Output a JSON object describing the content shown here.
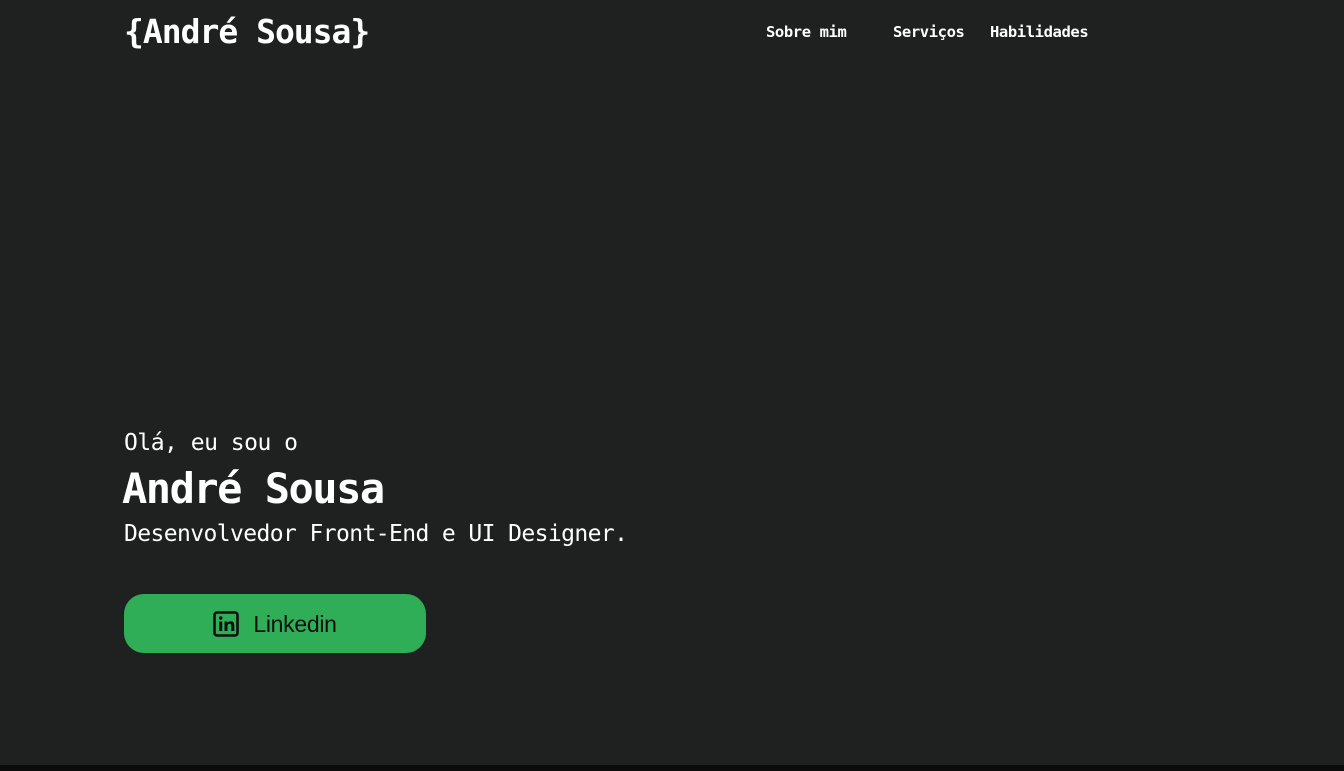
{
  "header": {
    "logo": "{André Sousa}",
    "nav": [
      {
        "label": "Sobre mim"
      },
      {
        "label": "Serviços"
      },
      {
        "label": "Habilidades"
      }
    ]
  },
  "hero": {
    "greeting": "Olá, eu sou o",
    "name": "André Sousa",
    "role": "Desenvolvedor Front-End e UI Designer.",
    "cta": {
      "label": "Linkedin",
      "icon": "linkedin-icon"
    }
  },
  "colors": {
    "background": "#1f2020",
    "accent": "#2fae57",
    "text": "#ffffff",
    "button_text": "#0f0f0f"
  }
}
